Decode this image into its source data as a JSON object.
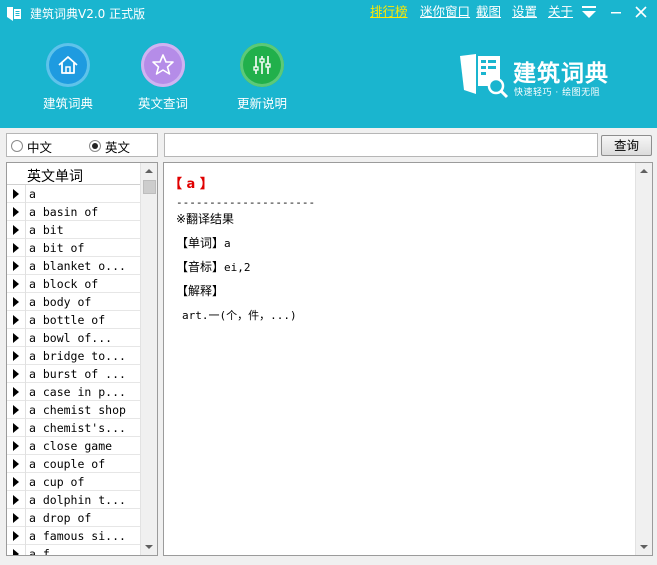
{
  "app": {
    "title": "建筑词典V2.0 正式版"
  },
  "toplinks": [
    "排行榜",
    "迷你窗口",
    "截图",
    "设置",
    "关于"
  ],
  "nav": [
    {
      "label": "建筑词典",
      "icon": "home-icon",
      "color": "#1e9be0"
    },
    {
      "label": "英文查词",
      "icon": "star-icon",
      "color": "#b58ce8"
    },
    {
      "label": "更新说明",
      "icon": "sliders-icon",
      "color": "#21b04b"
    }
  ],
  "logo": {
    "text": "建筑词典",
    "subtitle": "快速轻巧 · 绘图无阻"
  },
  "lang": {
    "options": [
      "中文",
      "英文"
    ],
    "selected": "英文"
  },
  "search": {
    "value": "",
    "button": "查询"
  },
  "wordlist": {
    "header": "英文单词",
    "items": [
      "a",
      "a basin of",
      "a bit",
      "a bit of",
      "a blanket o...",
      "a block of",
      "a body of",
      "a bottle of",
      "a bowl of...",
      "a bridge to...",
      "a burst of ...",
      "a case in p...",
      "a chemist shop",
      "a chemist's...",
      "a close game",
      "a couple of",
      "a cup of",
      "a dolphin t...",
      "a drop of",
      "a famous si...",
      "a f"
    ]
  },
  "result": {
    "head": "【 a 】",
    "dashes": "---------------------",
    "title": "※翻译结果",
    "word_label": "【单词】",
    "word_value": "a",
    "phonetic_label": "【音标】",
    "phonetic_value": "ei,2",
    "explain_label": "【解释】",
    "definition": "art.一(个，件，...)"
  },
  "colors": {
    "header": "#1ab5cf",
    "accent_link": "#ffe800",
    "result_head": "#e00000"
  }
}
